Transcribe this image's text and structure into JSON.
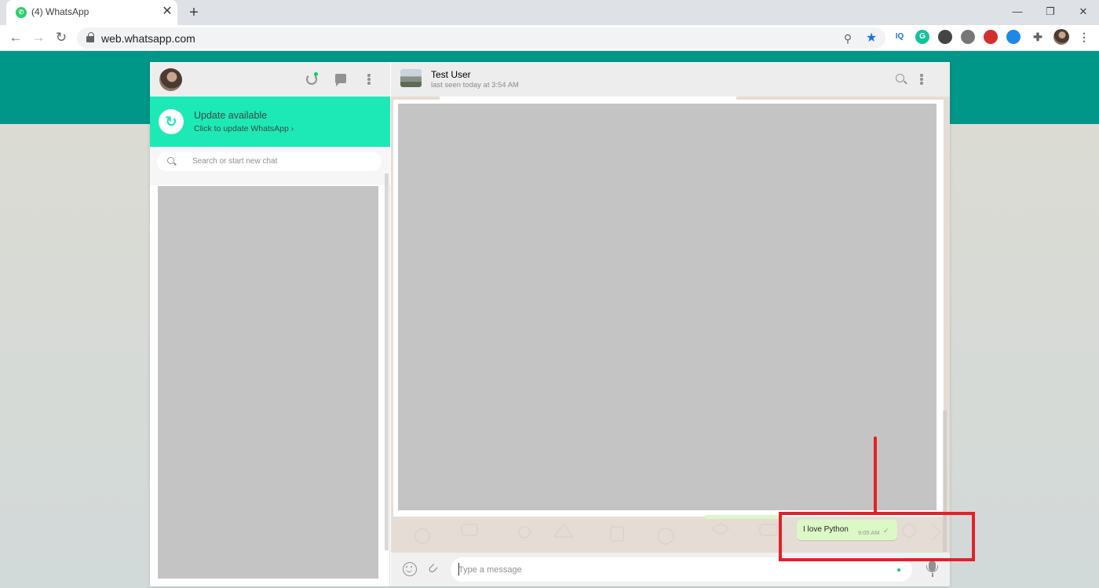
{
  "browser": {
    "tab_title": "(4) WhatsApp",
    "tab_close": "✕",
    "new_tab": "+",
    "url": "web.whatsapp.com",
    "window_controls": {
      "minimize": "—",
      "restore": "❐",
      "close": "✕"
    },
    "nav": {
      "back": "←",
      "forward": "→",
      "reload": "↻"
    },
    "extensions": [
      {
        "name": "iq-extension-icon",
        "label": "IQ",
        "color": "#1a73e8"
      },
      {
        "name": "grammarly-icon",
        "label": "G",
        "color": "#15c39a"
      },
      {
        "name": "circle-extension-icon",
        "label": "",
        "color": "#444444"
      },
      {
        "name": "globe-extension-icon",
        "label": "",
        "color": "#777777"
      },
      {
        "name": "adblock-icon",
        "label": "",
        "color": "#d32f2f"
      },
      {
        "name": "bug-extension-icon",
        "label": "",
        "color": "#1e88e5"
      }
    ]
  },
  "whatsapp": {
    "colors": {
      "teal": "#009688",
      "banner": "#1de9b6",
      "outgoing_bubble": "#dcf8c6",
      "annotation": "#e3202a"
    },
    "left": {
      "update_title": "Update available",
      "update_subtitle": "Click to update WhatsApp ›",
      "search_placeholder": "Search or start new chat"
    },
    "chat": {
      "contact_name": "Test User",
      "last_seen": "last seen today at 3:54 AM",
      "message_text": "I love Python",
      "message_time": "9:05 AM",
      "message_tick": "✓",
      "input_placeholder": "Type a message"
    }
  }
}
